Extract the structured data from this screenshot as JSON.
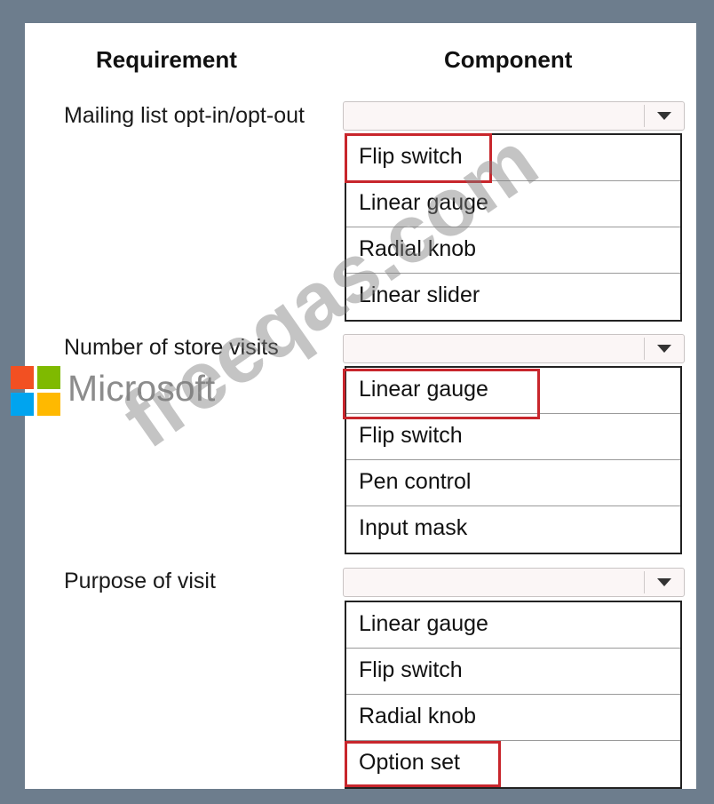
{
  "headers": {
    "requirement": "Requirement",
    "component": "Component"
  },
  "rows": [
    {
      "requirement": "Mailing list opt-in/opt-out",
      "options": [
        "Flip switch",
        "Linear gauge",
        "Radial knob",
        "Linear slider"
      ],
      "selected": "Flip switch"
    },
    {
      "requirement": "Number of store visits",
      "options": [
        "Linear gauge",
        "Flip switch",
        "Pen control",
        "Input mask"
      ],
      "selected": "Linear gauge"
    },
    {
      "requirement": "Purpose of visit",
      "options": [
        "Linear gauge",
        "Flip switch",
        "Radial knob",
        "Option set"
      ],
      "selected": "Option set"
    }
  ],
  "logo_text": "Microsoft",
  "watermark_text": "freeqas.com",
  "colors": {
    "highlight": "#c8262c",
    "logo_red": "#f25022",
    "logo_green": "#7fba00",
    "logo_blue": "#00a4ef",
    "logo_yellow": "#ffb900"
  }
}
